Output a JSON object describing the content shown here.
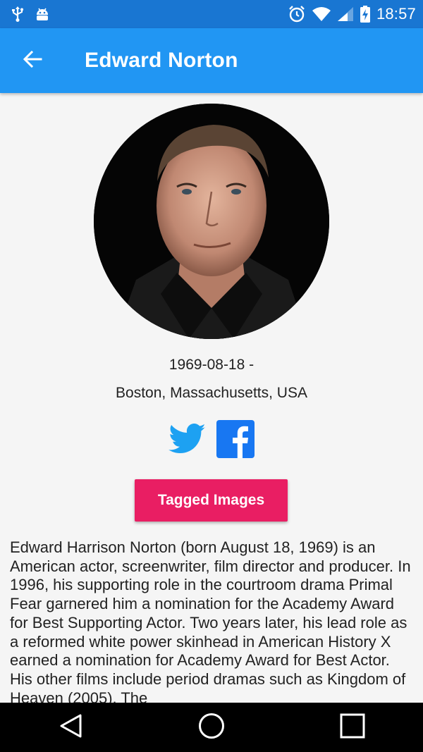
{
  "status_bar": {
    "time": "18:57",
    "left_icons": [
      "usb-icon",
      "android-debug-icon"
    ],
    "right_icons": [
      "alarm-icon",
      "wifi-icon",
      "signal-icon",
      "battery-charging-icon"
    ]
  },
  "app_bar": {
    "title": "Edward Norton",
    "back_icon": "arrow-back-icon"
  },
  "profile": {
    "birth": "1969-08-18 -",
    "place": "Boston, Massachusetts, USA",
    "social": [
      {
        "name": "twitter",
        "icon": "twitter-icon",
        "color": "#1da1f2"
      },
      {
        "name": "facebook",
        "icon": "facebook-icon",
        "color": "#1877f2"
      }
    ],
    "tagged_button": "Tagged Images",
    "bio": "Edward Harrison Norton (born August 18, 1969) is an American actor, screenwriter, film director and producer. In 1996, his supporting role in the courtroom drama Primal Fear garnered him a nomination for the Academy Award for Best Supporting Actor. Two years later, his lead role as a reformed white power skinhead in American History X earned a nomination for Academy Award for Best Actor. His other films include period dramas such as Kingdom of Heaven (2005). The"
  },
  "colors": {
    "status_bar": "#1976d2",
    "app_bar": "#2196f3",
    "accent": "#e91e63",
    "background": "#f5f5f5"
  },
  "nav_bar": {
    "buttons": [
      "back-triangle-icon",
      "home-circle-icon",
      "recents-square-icon"
    ]
  }
}
